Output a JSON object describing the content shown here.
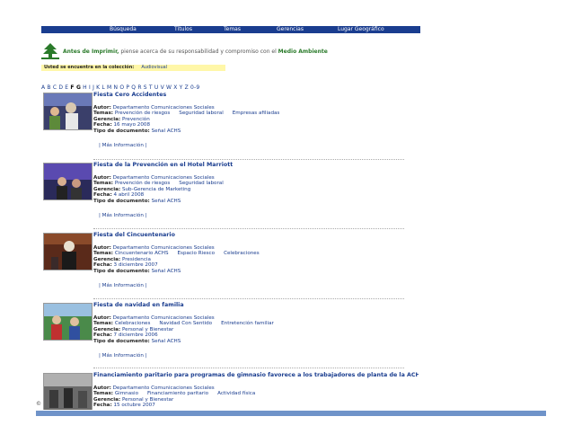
{
  "nav": {
    "items": [
      "Búsqueda",
      "Títulos",
      "Temas",
      "Gerencias",
      "Lugar Geográfico"
    ]
  },
  "print_notice": {
    "prefix": "Antes de Imprimir,",
    "middle": " piense acerca de su responsabilidad y compromiso con el ",
    "highlight": "Medio Ambiente"
  },
  "collection": {
    "label": "Usted se encuentra en la colección:",
    "value": "Audiovisual"
  },
  "alphabet": {
    "normal_before": "A B C D E ",
    "bold": "F G",
    "normal_after": " H I J K L M N O P Q R S T U V W X Y Z 0-9"
  },
  "labels": {
    "autor": "Autor:",
    "temas": "Temas:",
    "gerencia": "Gerencia:",
    "fecha": "Fecha:",
    "tipo": "Tipo de documento:",
    "more": "Más Información"
  },
  "records": [
    {
      "title": "Fiesta Cero Accidentes",
      "autor": "Departamento Comunicaciones Sociales",
      "temas": [
        "Prevención de riesgos",
        "Seguridad laboral",
        "Empresas afiliadas"
      ],
      "gerencia": "Prevención",
      "fecha": "16 mayo 2008",
      "tipo": "Señal ACHS"
    },
    {
      "title": "Fiesta de la Prevención en el Hotel Marriott",
      "autor": "Departamento Comunicaciones Sociales",
      "temas": [
        "Prevención de riesgos",
        "Seguridad laboral"
      ],
      "gerencia": "Sub-Gerencia de Marketing",
      "fecha": "4 abril 2008",
      "tipo": "Señal ACHS"
    },
    {
      "title": "Fiesta del Cincuentenario",
      "autor": "Departamento Comunicaciones Sociales",
      "temas": [
        "Cincuentenario ACHS",
        "Espacio Riesco",
        "Celebraciones"
      ],
      "gerencia": "Presidencia",
      "fecha": "3 diciembre 2007",
      "tipo": "Señal ACHS"
    },
    {
      "title": "Fiesta de navidad en familia",
      "autor": "Departamento Comunicaciones Sociales",
      "temas": [
        "Celebraciones",
        "Navidad Con Sentido",
        "Entretención familiar"
      ],
      "gerencia": "Personal y Bienestar",
      "fecha": "7 diciembre 2006",
      "tipo": "Señal ACHS"
    },
    {
      "title": "Financiamiento paritario para programas de gimnasio favorece a los trabajadores de planta de la ACHS",
      "autor": "Departamento Comunicaciones Sociales",
      "temas": [
        "Gimnasio",
        "Financiamiento paritario",
        "Actividad física"
      ],
      "gerencia": "Personal y Bienestar",
      "fecha": "15 octubre 2007",
      "tipo": ""
    }
  ],
  "copyright": "©",
  "colors": {
    "nav_bg": "#1a3d8f",
    "link": "#1a3d8f",
    "green": "#2a7a2a",
    "collection_bg": "#fff7a8",
    "bottom_bar": "#6f93c9"
  }
}
